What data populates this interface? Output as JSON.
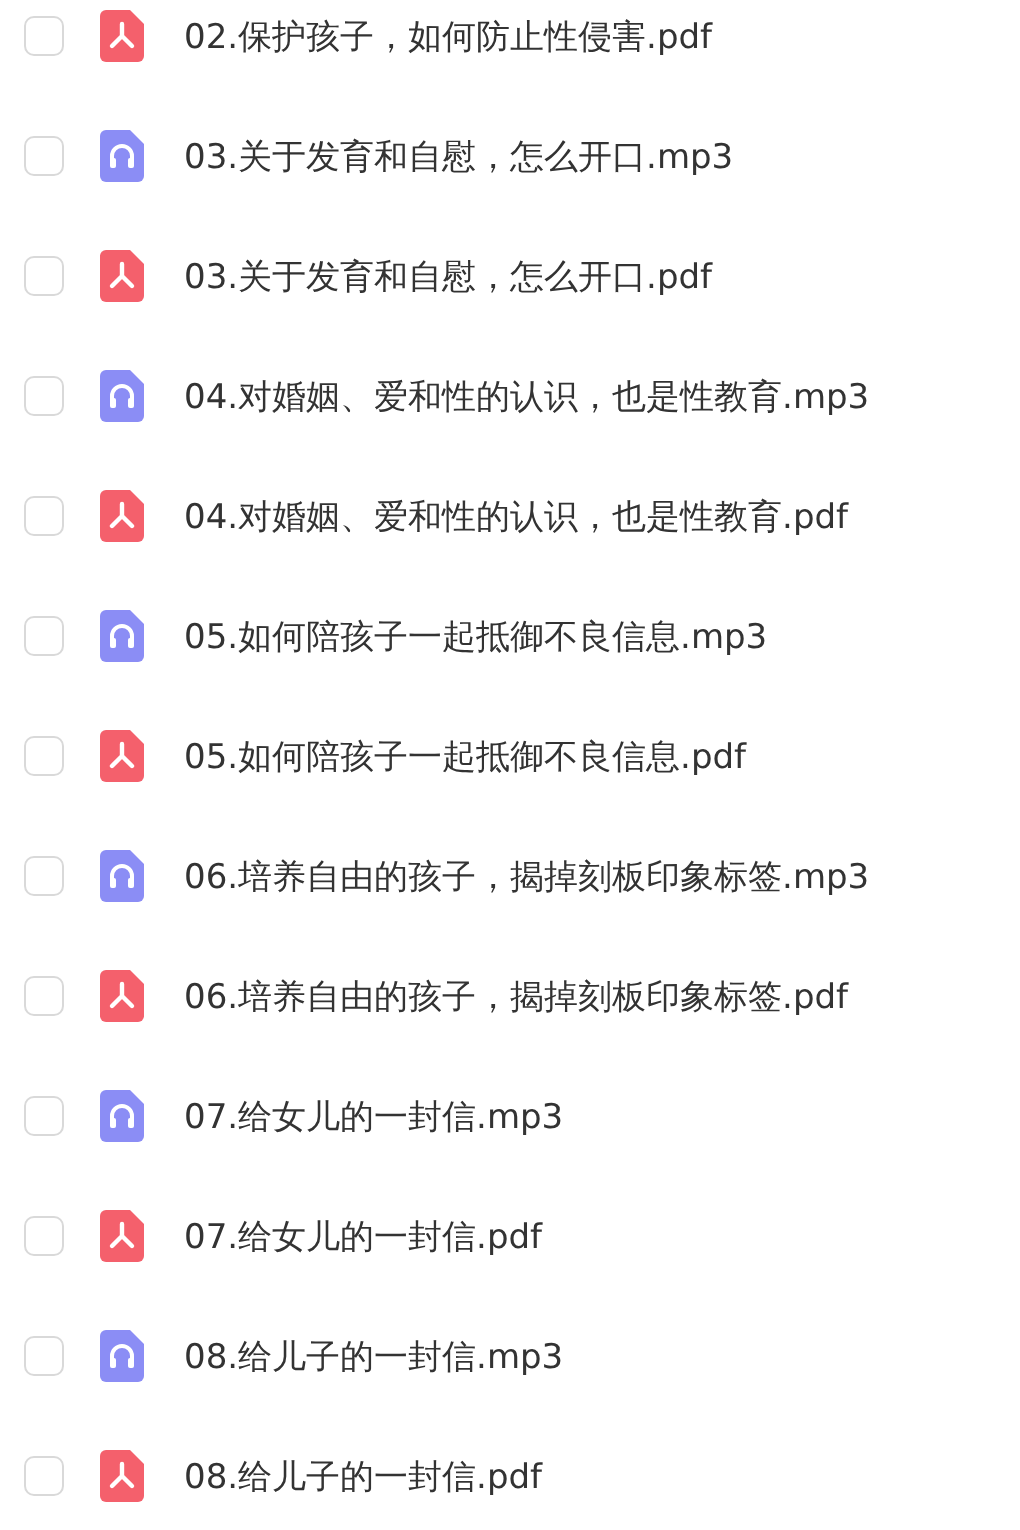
{
  "files": [
    {
      "name": "02.保护孩子，如何防止性侵害.pdf",
      "kind": "pdf",
      "checked": false
    },
    {
      "name": "03.关于发育和自慰，怎么开口.mp3",
      "kind": "audio",
      "checked": false
    },
    {
      "name": "03.关于发育和自慰，怎么开口.pdf",
      "kind": "pdf",
      "checked": false
    },
    {
      "name": "04.对婚姻、爱和性的认识，也是性教育.mp3",
      "kind": "audio",
      "checked": false
    },
    {
      "name": "04.对婚姻、爱和性的认识，也是性教育.pdf",
      "kind": "pdf",
      "checked": false
    },
    {
      "name": "05.如何陪孩子一起抵御不良信息.mp3",
      "kind": "audio",
      "checked": false
    },
    {
      "name": "05.如何陪孩子一起抵御不良信息.pdf",
      "kind": "pdf",
      "checked": false
    },
    {
      "name": "06.培养自由的孩子，揭掉刻板印象标签.mp3",
      "kind": "audio",
      "checked": false
    },
    {
      "name": "06.培养自由的孩子，揭掉刻板印象标签.pdf",
      "kind": "pdf",
      "checked": false
    },
    {
      "name": "07.给女儿的一封信.mp3",
      "kind": "audio",
      "checked": false
    },
    {
      "name": "07.给女儿的一封信.pdf",
      "kind": "pdf",
      "checked": false
    },
    {
      "name": "08.给儿子的一封信.mp3",
      "kind": "audio",
      "checked": false
    },
    {
      "name": "08.给儿子的一封信.pdf",
      "kind": "pdf",
      "checked": false
    }
  ]
}
